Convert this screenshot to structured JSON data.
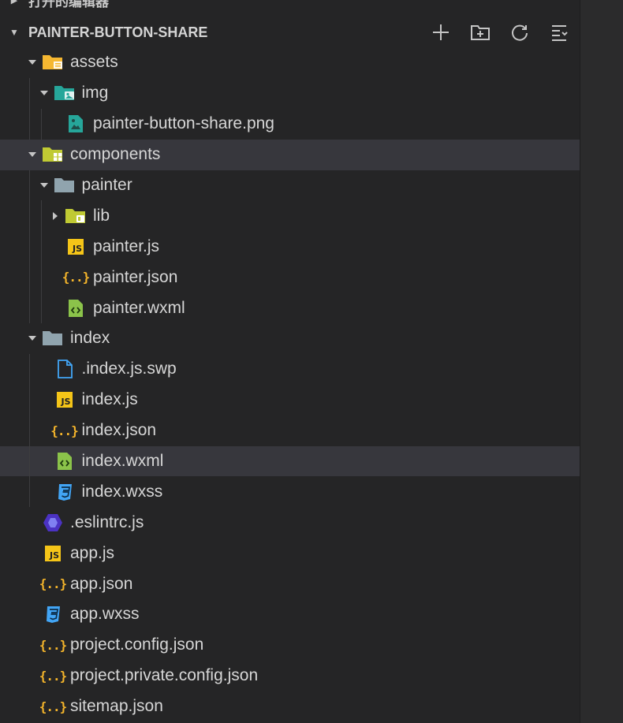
{
  "open_editors": {
    "label": "打开的编辑器"
  },
  "project": {
    "title": "PAINTER-BUTTON-SHARE"
  },
  "actions": [
    {
      "name": "new-file-button",
      "icon": "plus-icon"
    },
    {
      "name": "new-folder-button",
      "icon": "new-folder-icon"
    },
    {
      "name": "refresh-button",
      "icon": "refresh-icon"
    },
    {
      "name": "collapse-all-button",
      "icon": "collapse-all-icon"
    }
  ],
  "tree": [
    {
      "label": "assets",
      "depth": 0,
      "twisty": "open",
      "icon": "folder-assets",
      "selected": false
    },
    {
      "label": "img",
      "depth": 1,
      "twisty": "open",
      "icon": "folder-img",
      "selected": false
    },
    {
      "label": "painter-button-share.png",
      "depth": 2,
      "twisty": "none",
      "icon": "image",
      "selected": false
    },
    {
      "label": "components",
      "depth": 0,
      "twisty": "open",
      "icon": "folder-components",
      "selected": true
    },
    {
      "label": "painter",
      "depth": 1,
      "twisty": "open",
      "icon": "folder",
      "selected": false
    },
    {
      "label": "lib",
      "depth": 2,
      "twisty": "closed",
      "icon": "folder-lib",
      "selected": false
    },
    {
      "label": "painter.js",
      "depth": 2,
      "twisty": "none",
      "icon": "js",
      "selected": false
    },
    {
      "label": "painter.json",
      "depth": 2,
      "twisty": "none",
      "icon": "json",
      "selected": false
    },
    {
      "label": "painter.wxml",
      "depth": 2,
      "twisty": "none",
      "icon": "wxml",
      "selected": false
    },
    {
      "label": "index",
      "depth": 0,
      "twisty": "open",
      "icon": "folder",
      "selected": false
    },
    {
      "label": ".index.js.swp",
      "depth": 1,
      "twisty": "none",
      "icon": "file",
      "selected": false
    },
    {
      "label": "index.js",
      "depth": 1,
      "twisty": "none",
      "icon": "js",
      "selected": false
    },
    {
      "label": "index.json",
      "depth": 1,
      "twisty": "none",
      "icon": "json",
      "selected": false
    },
    {
      "label": "index.wxml",
      "depth": 1,
      "twisty": "none",
      "icon": "wxml",
      "selected": true
    },
    {
      "label": "index.wxss",
      "depth": 1,
      "twisty": "none",
      "icon": "css",
      "selected": false
    },
    {
      "label": ".eslintrc.js",
      "depth": 0,
      "twisty": "none",
      "icon": "eslint",
      "selected": false
    },
    {
      "label": "app.js",
      "depth": 0,
      "twisty": "none",
      "icon": "js",
      "selected": false
    },
    {
      "label": "app.json",
      "depth": 0,
      "twisty": "none",
      "icon": "json",
      "selected": false
    },
    {
      "label": "app.wxss",
      "depth": 0,
      "twisty": "none",
      "icon": "css",
      "selected": false
    },
    {
      "label": "project.config.json",
      "depth": 0,
      "twisty": "none",
      "icon": "json",
      "selected": false
    },
    {
      "label": "project.private.config.json",
      "depth": 0,
      "twisty": "none",
      "icon": "json",
      "selected": false
    },
    {
      "label": "sitemap.json",
      "depth": 0,
      "twisty": "none",
      "icon": "json",
      "selected": false
    }
  ],
  "colors": {
    "background": "#252526",
    "selection": "#37373d",
    "folder": "#90a4ae",
    "folder_assets": "#f5b731",
    "folder_img": "#26a69a",
    "folder_components": "#c0ca33",
    "js": "#f5c518",
    "json": "#f5b52b",
    "wxml": "#8bc34a",
    "css": "#42a5f5",
    "eslint": "#4b32c3"
  }
}
